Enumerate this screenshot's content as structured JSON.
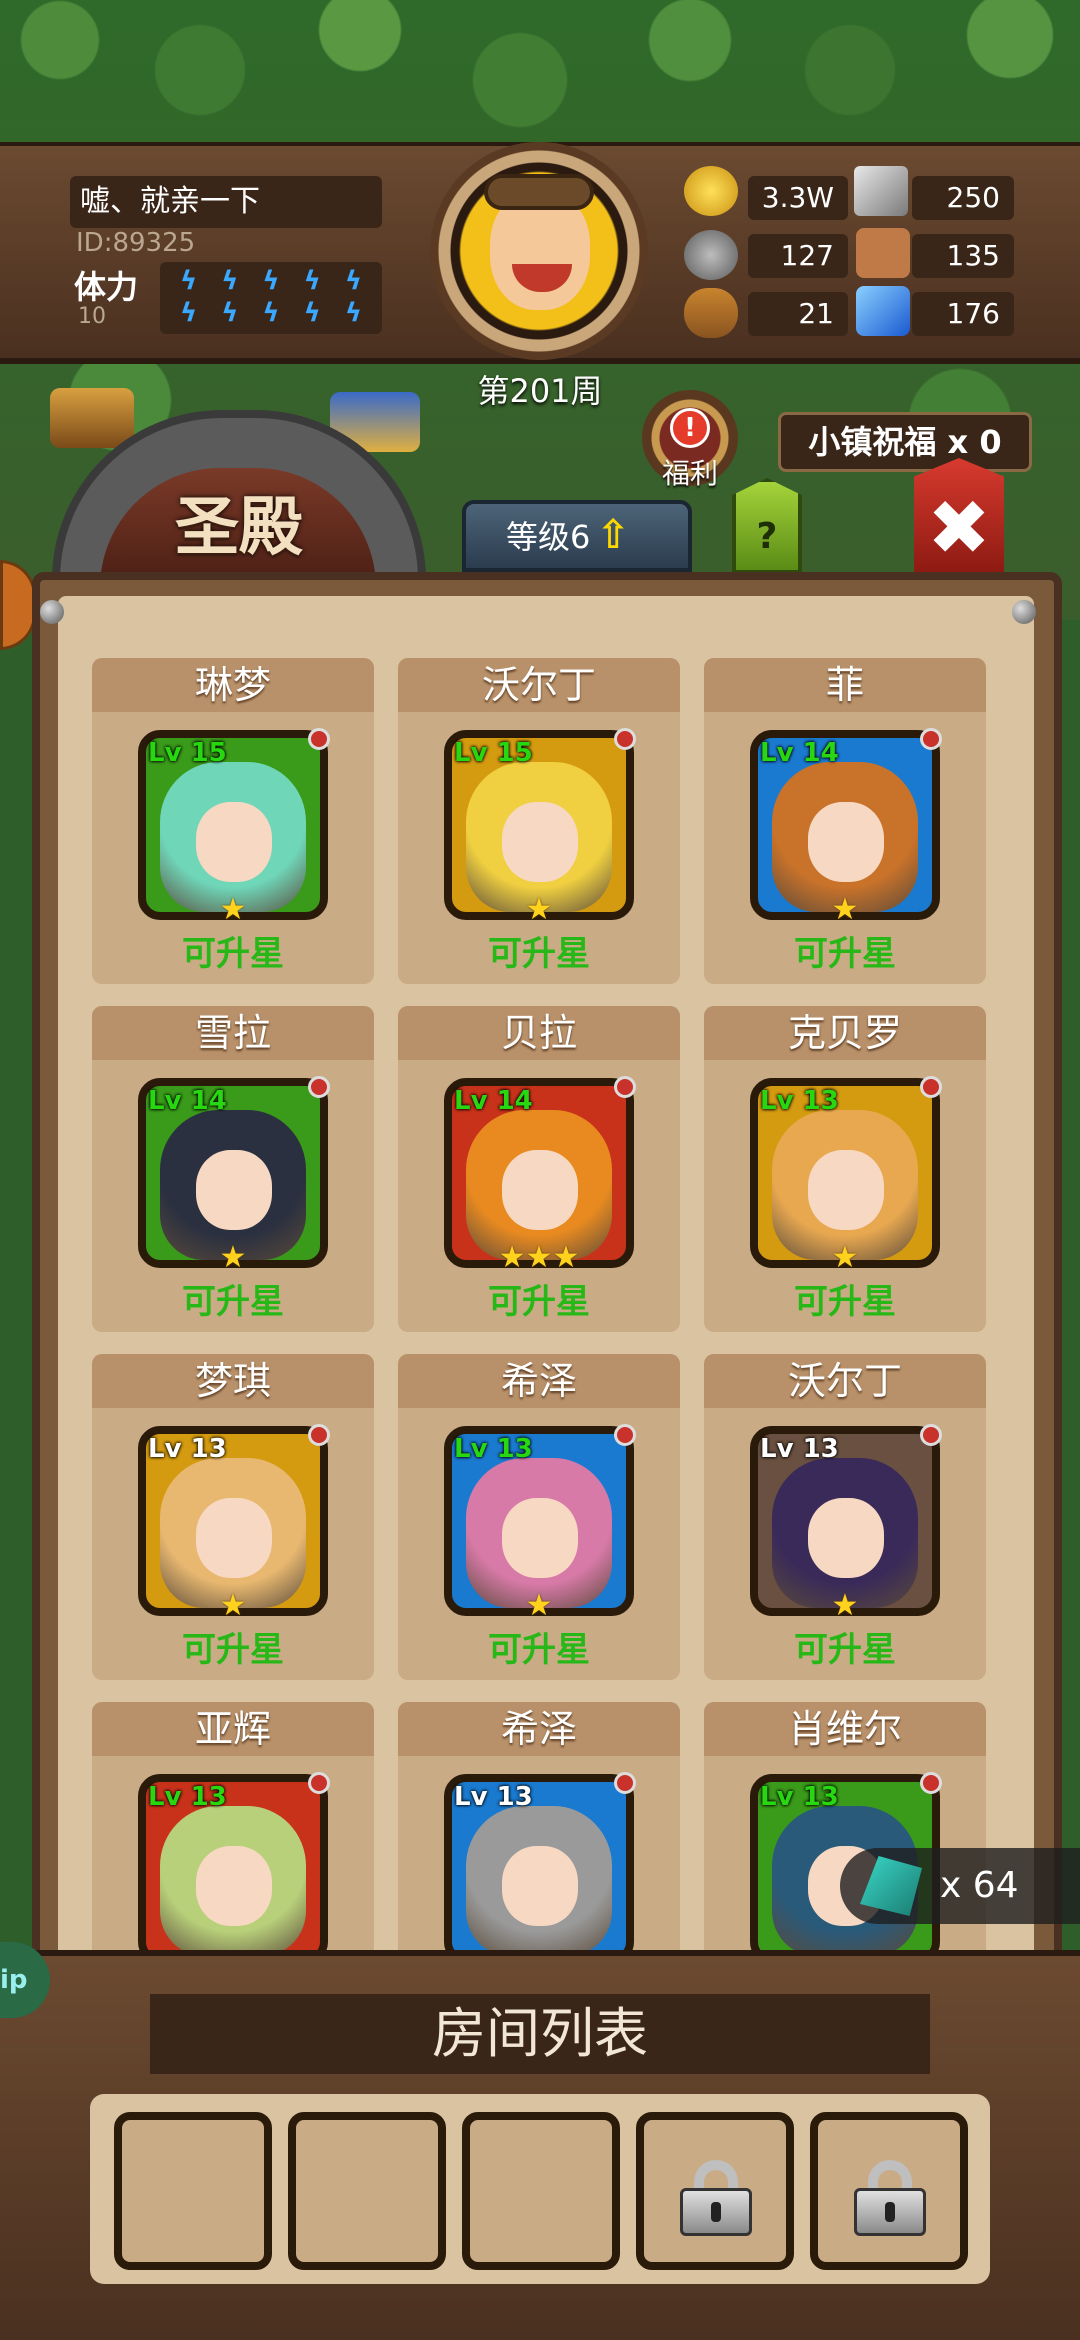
{
  "player": {
    "name": "嘘、就亲一下",
    "id": "ID:89325",
    "stamina_label": "体力",
    "stamina_value": "10",
    "week": "第201周"
  },
  "resources": [
    {
      "icon": "gold-coin-icon",
      "value": "3.3W"
    },
    {
      "icon": "iron-ingot-icon",
      "value": "250"
    },
    {
      "icon": "stone-icon",
      "value": "127"
    },
    {
      "icon": "leather-icon",
      "value": "135"
    },
    {
      "icon": "wood-log-icon",
      "value": "21"
    },
    {
      "icon": "blue-crystal-icon",
      "value": "176"
    }
  ],
  "top": {
    "welfare_label": "福利",
    "welfare_alert": "!",
    "blessing": "小镇祝福 x 0",
    "building_title": "圣殿",
    "level": "等级6",
    "help": "?"
  },
  "heroes": [
    {
      "name": "琳梦",
      "lv": "Lv 15",
      "stars": "★",
      "status": "可升星",
      "frame": "#3a9a1a",
      "hair": "#6fd6b8"
    },
    {
      "name": "沃尔丁",
      "lv": "Lv 15",
      "stars": "★",
      "status": "可升星",
      "frame": "#d49a10",
      "hair": "#f0d040"
    },
    {
      "name": "菲",
      "lv": "Lv 14",
      "stars": "★",
      "status": "可升星",
      "frame": "#1a7ad0",
      "hair": "#c8722a"
    },
    {
      "name": "雪拉",
      "lv": "Lv 14",
      "stars": "★",
      "status": "可升星",
      "frame": "#3a9a1a",
      "hair": "#2a3040"
    },
    {
      "name": "贝拉",
      "lv": "Lv 14",
      "stars": "★★★",
      "status": "可升星",
      "frame": "#c8321a",
      "hair": "#e88a20"
    },
    {
      "name": "克贝罗",
      "lv": "Lv 13",
      "stars": "★",
      "status": "可升星",
      "frame": "#d49a10",
      "hair": "#e8a850"
    },
    {
      "name": "梦琪",
      "lv": "Lv 13",
      "stars": "★",
      "status": "可升星",
      "frame": "#d49a10",
      "hair": "#e8b870"
    },
    {
      "name": "希泽",
      "lv": "Lv 13",
      "stars": "★",
      "status": "可升星",
      "frame": "#1a7ad0",
      "hair": "#d87aa8"
    },
    {
      "name": "沃尔丁",
      "lv": "Lv 13",
      "stars": "★",
      "status": "可升星",
      "frame": "#6a5040",
      "hair": "#3a2a5a"
    },
    {
      "name": "亚辉",
      "lv": "Lv 13",
      "stars": "",
      "status": "",
      "frame": "#c8321a",
      "hair": "#b8d07a"
    },
    {
      "name": "希泽",
      "lv": "Lv 13",
      "stars": "",
      "status": "",
      "frame": "#1a7ad0",
      "hair": "#9a9a9a"
    },
    {
      "name": "肖维尔",
      "lv": "Lv 13",
      "stars": "",
      "status": "",
      "frame": "#3a9a1a",
      "hair": "#2a5a7a"
    }
  ],
  "crystal_count": "x 64",
  "room_list": {
    "title": "房间列表"
  },
  "side_badge": "ip"
}
